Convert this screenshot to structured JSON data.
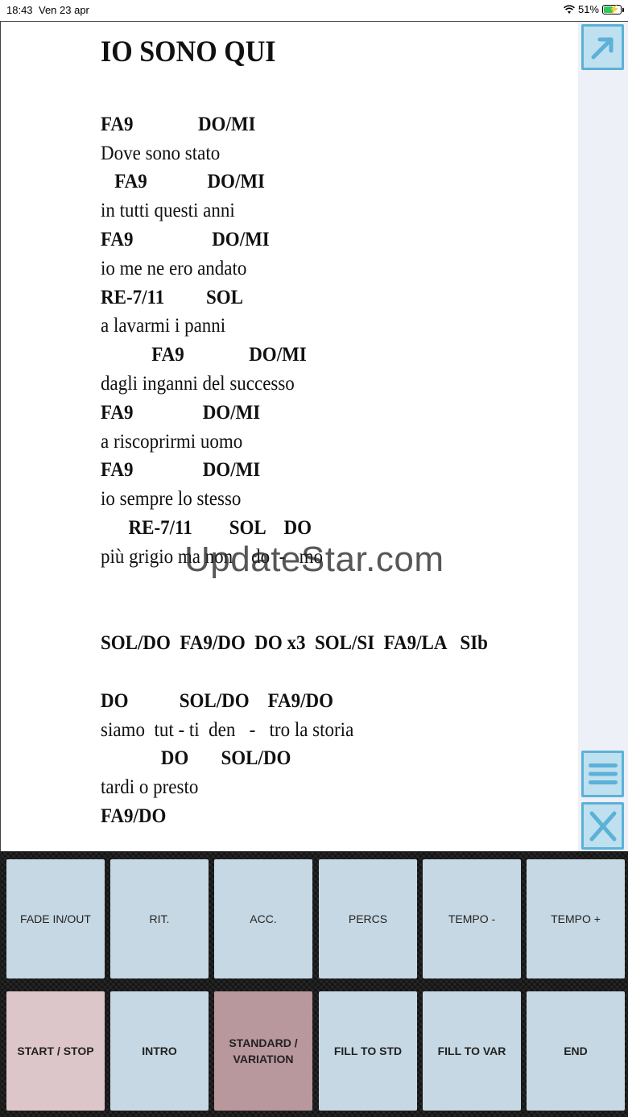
{
  "status_bar": {
    "time": "18:43",
    "date": "Ven 23 apr",
    "battery": "51%"
  },
  "song": {
    "title": "IO SONO QUI",
    "lines": [
      {
        "type": "chord",
        "text": "FA9              DO/MI"
      },
      {
        "type": "lyric",
        "text": "Dove sono stato"
      },
      {
        "type": "chord",
        "text": "   FA9             DO/MI"
      },
      {
        "type": "lyric",
        "text": "in tutti questi anni"
      },
      {
        "type": "chord",
        "text": "FA9                 DO/MI"
      },
      {
        "type": "lyric",
        "text": "io me ne ero andato"
      },
      {
        "type": "chord",
        "text": "RE-7/11         SOL"
      },
      {
        "type": "lyric",
        "text": "a lavarmi i panni"
      },
      {
        "type": "chord",
        "text": "           FA9              DO/MI"
      },
      {
        "type": "lyric",
        "text": "dagli inganni del successo"
      },
      {
        "type": "chord",
        "text": "FA9               DO/MI"
      },
      {
        "type": "lyric",
        "text": "a riscoprirmi uomo"
      },
      {
        "type": "chord",
        "text": "FA9               DO/MI"
      },
      {
        "type": "lyric",
        "text": "io sempre lo stesso"
      },
      {
        "type": "chord",
        "text": "      RE-7/11        SOL    DO"
      },
      {
        "type": "lyric",
        "text": "più grigio ma non    do  -   mo"
      },
      {
        "type": "blank",
        "text": ""
      },
      {
        "type": "blank",
        "text": ""
      },
      {
        "type": "chord",
        "text": "SOL/DO  FA9/DO  DO x3  SOL/SI  FA9/LA   SIb"
      },
      {
        "type": "blank",
        "text": ""
      },
      {
        "type": "chord",
        "text": "DO           SOL/DO    FA9/DO"
      },
      {
        "type": "lyric",
        "text": "siamo  tut - ti  den   -   tro la storia"
      },
      {
        "type": "chord",
        "text": "             DO       SOL/DO"
      },
      {
        "type": "lyric",
        "text": "tardi o presto"
      },
      {
        "type": "chord",
        "text": "FA9/DO"
      }
    ]
  },
  "watermark": "UpdateStar.com",
  "side_buttons": {
    "expand": "expand-arrow-icon",
    "menu": "hamburger-menu-icon",
    "close": "close-x-icon"
  },
  "pad": {
    "row1": [
      "FADE IN/OUT",
      "RIT.",
      "ACC.",
      "PERCS",
      "TEMPO -",
      "TEMPO +"
    ],
    "row2": [
      "START / STOP",
      "INTRO",
      "STANDARD / VARIATION",
      "FILL TO STD",
      "FILL TO VAR",
      "END"
    ]
  },
  "colors": {
    "key_blue": "#c6d8e3",
    "key_pink": "#ddc6c9",
    "key_rose": "#b8979d",
    "side_button": "#5cb1d8"
  }
}
